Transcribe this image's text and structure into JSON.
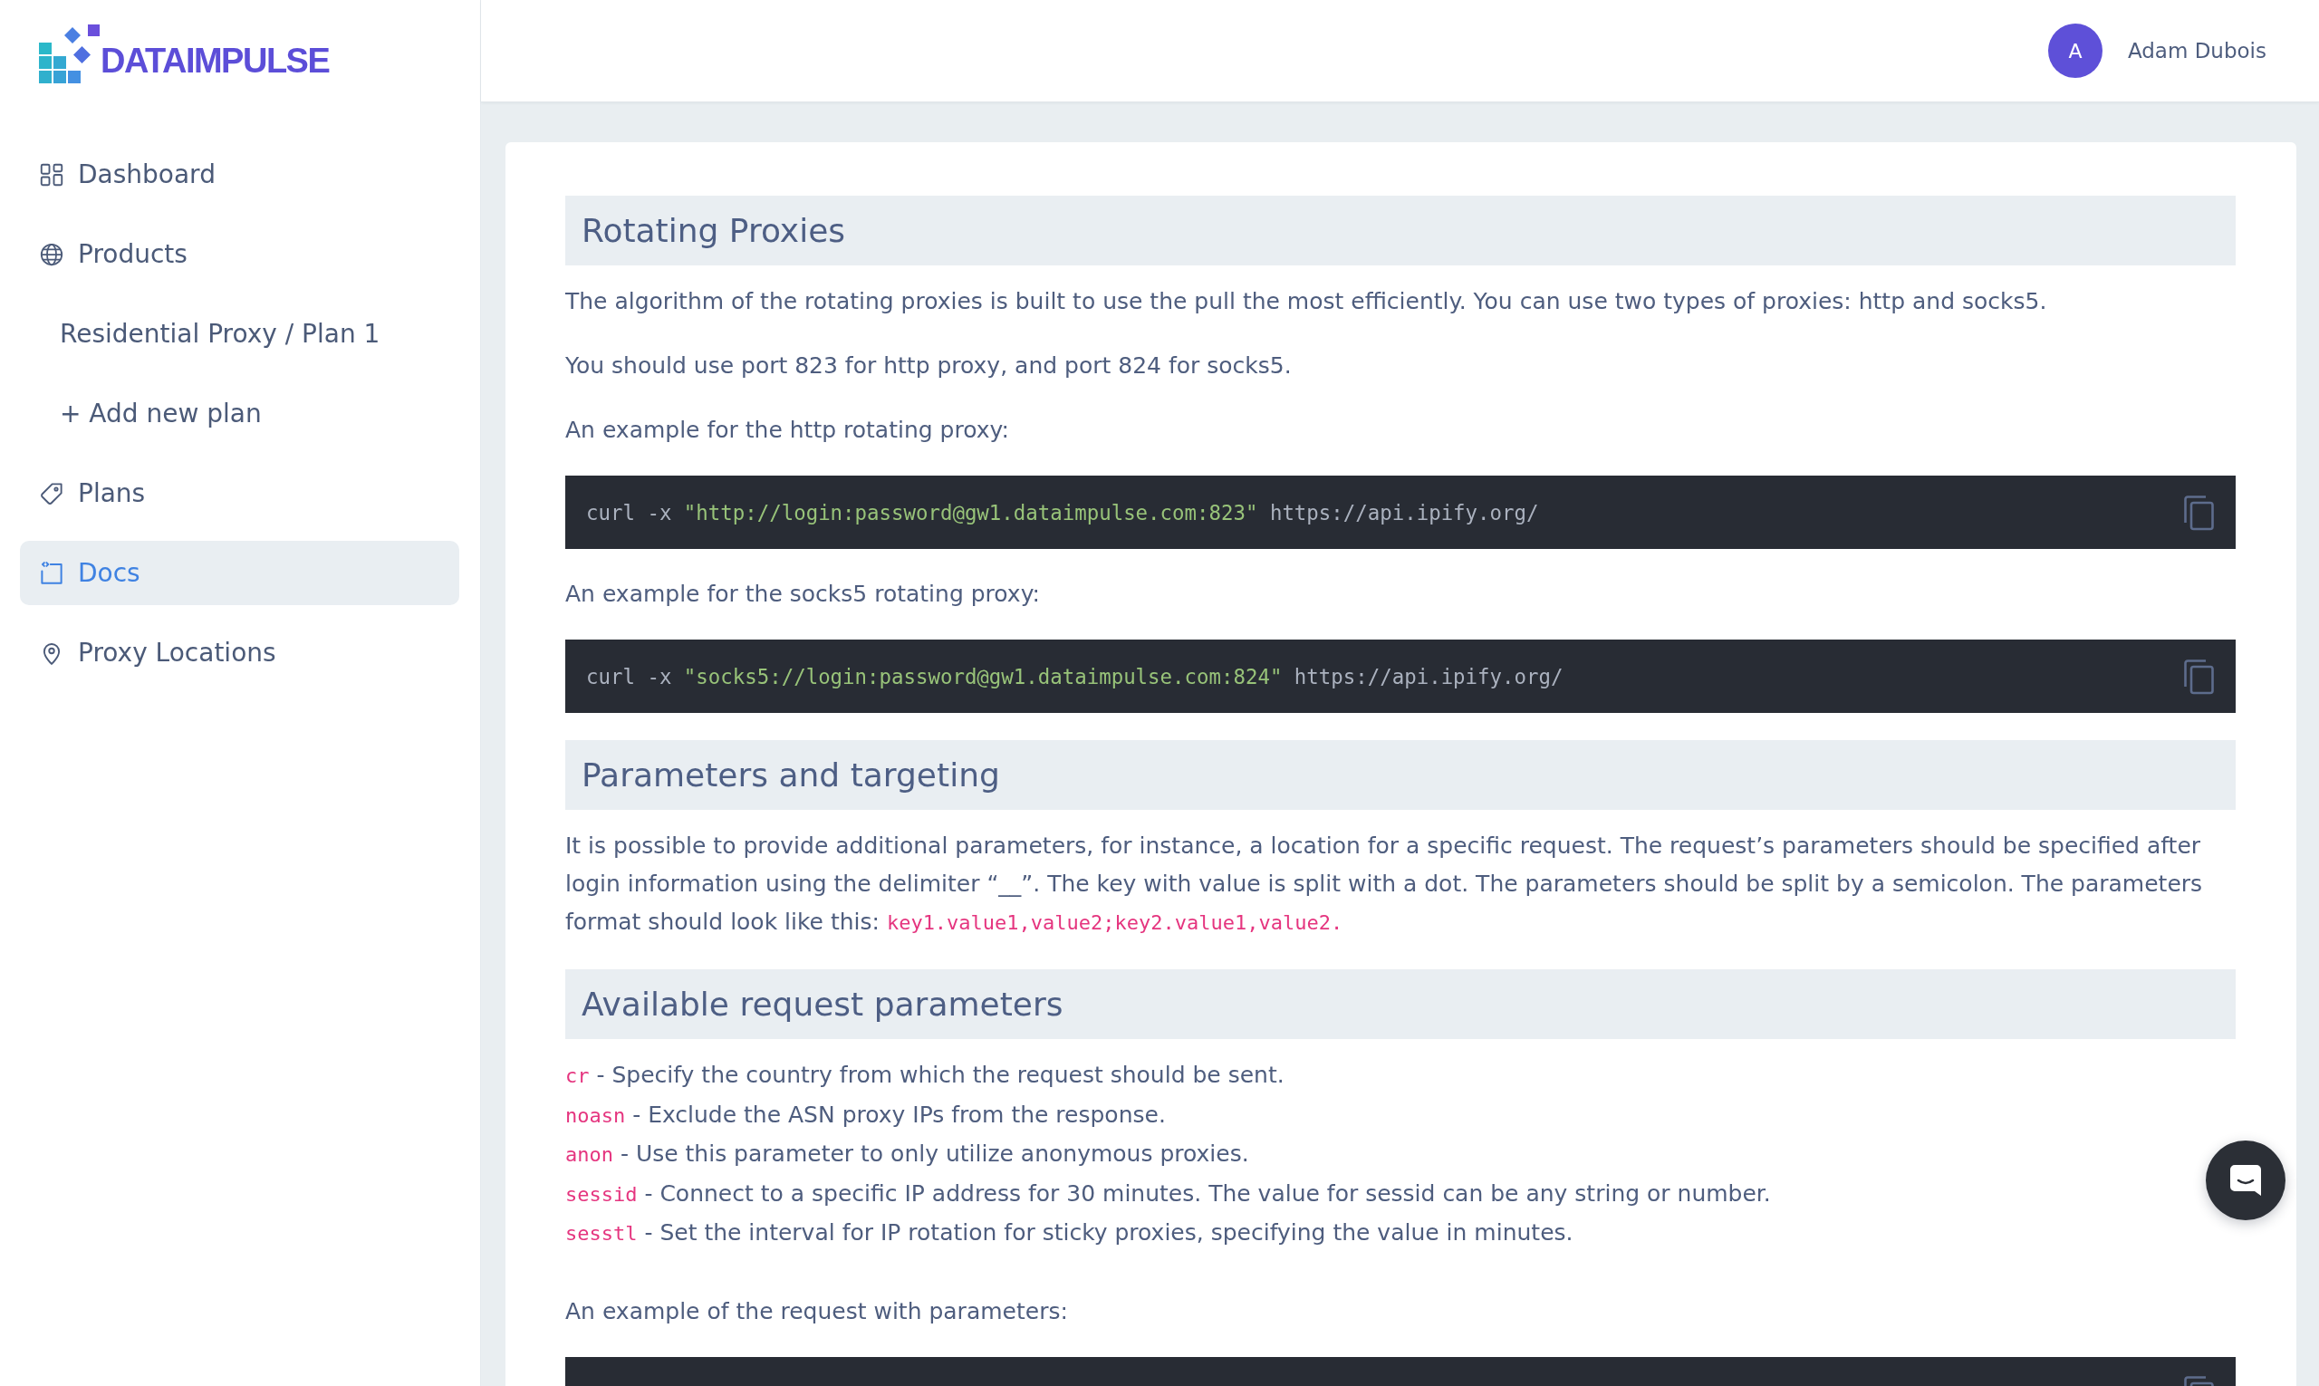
{
  "logo": {
    "text": "DATAIMPULSE"
  },
  "sidebar": {
    "items": [
      {
        "kind": "nav",
        "label": "Dashboard",
        "selected": false
      },
      {
        "kind": "nav",
        "label": "Products",
        "selected": false
      },
      {
        "kind": "sub",
        "label": "Residential Proxy / Plan 1",
        "selected": false
      },
      {
        "kind": "sub",
        "label": "+ Add new plan",
        "selected": false
      },
      {
        "kind": "nav",
        "label": "Plans",
        "selected": false
      },
      {
        "kind": "nav",
        "label": "Docs",
        "selected": true
      },
      {
        "kind": "nav",
        "label": "Proxy Locations",
        "selected": false
      }
    ]
  },
  "header": {
    "user": {
      "initial": "A",
      "name": "Adam Dubois"
    }
  },
  "docs": {
    "blocks": [
      {
        "kind": "heading",
        "text": "Rotating Proxies"
      },
      {
        "kind": "paragraph",
        "parts": [
          {
            "kind": "text",
            "text": "The algorithm of the rotating proxies is built to use the pull the most efficiently. You can use two types of proxies: http and socks5."
          }
        ]
      },
      {
        "kind": "paragraph",
        "parts": [
          {
            "kind": "text",
            "text": "You should use port 823 for http proxy, and port 824 for socks5."
          }
        ]
      },
      {
        "kind": "paragraph",
        "parts": [
          {
            "kind": "text",
            "text": "An example for the http rotating proxy:"
          }
        ]
      },
      {
        "kind": "code",
        "parts": [
          {
            "kind": "plain",
            "text": "curl -x "
          },
          {
            "kind": "string",
            "text": "\"http://login:password@gw1.dataimpulse.com:823\""
          },
          {
            "kind": "plain",
            "text": " https://api.ipify.org/"
          }
        ]
      },
      {
        "kind": "paragraph",
        "parts": [
          {
            "kind": "text",
            "text": "An example for the socks5 rotating proxy:"
          }
        ]
      },
      {
        "kind": "code",
        "parts": [
          {
            "kind": "plain",
            "text": "curl -x "
          },
          {
            "kind": "string",
            "text": "\"socks5://login:password@gw1.dataimpulse.com:824\""
          },
          {
            "kind": "plain",
            "text": " https://api.ipify.org/"
          }
        ]
      },
      {
        "kind": "heading",
        "text": "Parameters and targeting"
      },
      {
        "kind": "paragraph",
        "parts": [
          {
            "kind": "text",
            "text": "It is possible to provide additional parameters, for instance, a location for a specific request. The request’s parameters should be specified after login information using the delimiter “__”. The key with value is split with a dot. The parameters should be split by a semicolon. The parameters format should look like this: "
          },
          {
            "kind": "code",
            "text": "key1.value1,value2;key2.value1,value2."
          }
        ]
      },
      {
        "kind": "heading",
        "text": "Available request parameters"
      },
      {
        "kind": "list",
        "items": [
          {
            "parts": [
              {
                "kind": "code",
                "text": "cr"
              },
              {
                "kind": "text",
                "text": " - Specify the country from which the request should be sent."
              }
            ]
          },
          {
            "parts": [
              {
                "kind": "code",
                "text": "noasn"
              },
              {
                "kind": "text",
                "text": " - Exclude the ASN proxy IPs from the response."
              }
            ]
          },
          {
            "parts": [
              {
                "kind": "code",
                "text": "anon"
              },
              {
                "kind": "text",
                "text": " - Use this parameter to only utilize anonymous proxies."
              }
            ]
          },
          {
            "parts": [
              {
                "kind": "code",
                "text": "sessid"
              },
              {
                "kind": "text",
                "text": " - Connect to a specific IP address for 30 minutes. The value for sessid can be any string or number."
              }
            ]
          },
          {
            "parts": [
              {
                "kind": "code",
                "text": "sesstl"
              },
              {
                "kind": "text",
                "text": " - Set the interval for IP rotation for sticky proxies, specifying the value in minutes."
              }
            ]
          }
        ]
      },
      {
        "kind": "paragraph",
        "parts": [
          {
            "kind": "text",
            "text": "An example of the request with parameters:"
          }
        ]
      },
      {
        "kind": "code"
      }
    ]
  }
}
